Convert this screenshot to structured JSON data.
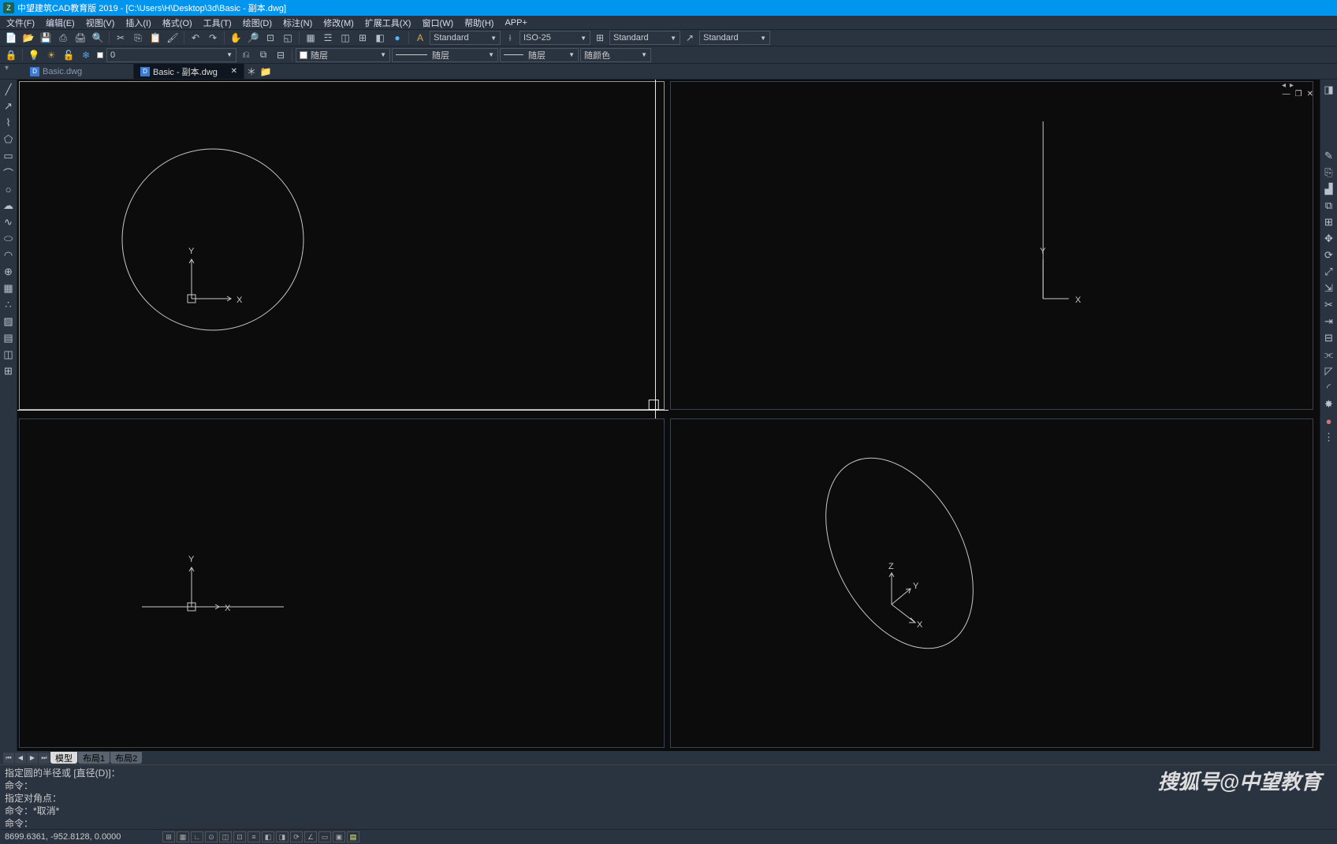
{
  "title": "中望建筑CAD教育版  2019 - [C:\\Users\\H\\Desktop\\3d\\Basic - 副本.dwg]",
  "menu": [
    "文件(F)",
    "编辑(E)",
    "视图(V)",
    "插入(I)",
    "格式(O)",
    "工具(T)",
    "绘图(D)",
    "标注(N)",
    "修改(M)",
    "扩展工具(X)",
    "窗口(W)",
    "帮助(H)",
    "APP+"
  ],
  "styles": {
    "text": "Standard",
    "dim": "ISO-25",
    "table": "Standard",
    "mleader": "Standard"
  },
  "layernum": "0",
  "layer_dd": "随层",
  "linetype": "随层",
  "lineweight": "随层",
  "color_by": "随颜色",
  "tabs": [
    {
      "label": "Basic.dwg",
      "active": false
    },
    {
      "label": "Basic - 副本.dwg",
      "active": true
    }
  ],
  "model_tabs": [
    "模型",
    "布局1",
    "布局2"
  ],
  "cmd": {
    "l1": "指定圆的半径或 [直径(D)]：",
    "l2": "命令：",
    "l3": "指定对角点：",
    "l4": "命令：*取消*",
    "l5": "命令："
  },
  "coords": "8699.6361, -952.8128, 0.0000",
  "axes": {
    "x": "X",
    "y": "Y",
    "z": "Z"
  },
  "watermark": "搜狐号@中望教育"
}
